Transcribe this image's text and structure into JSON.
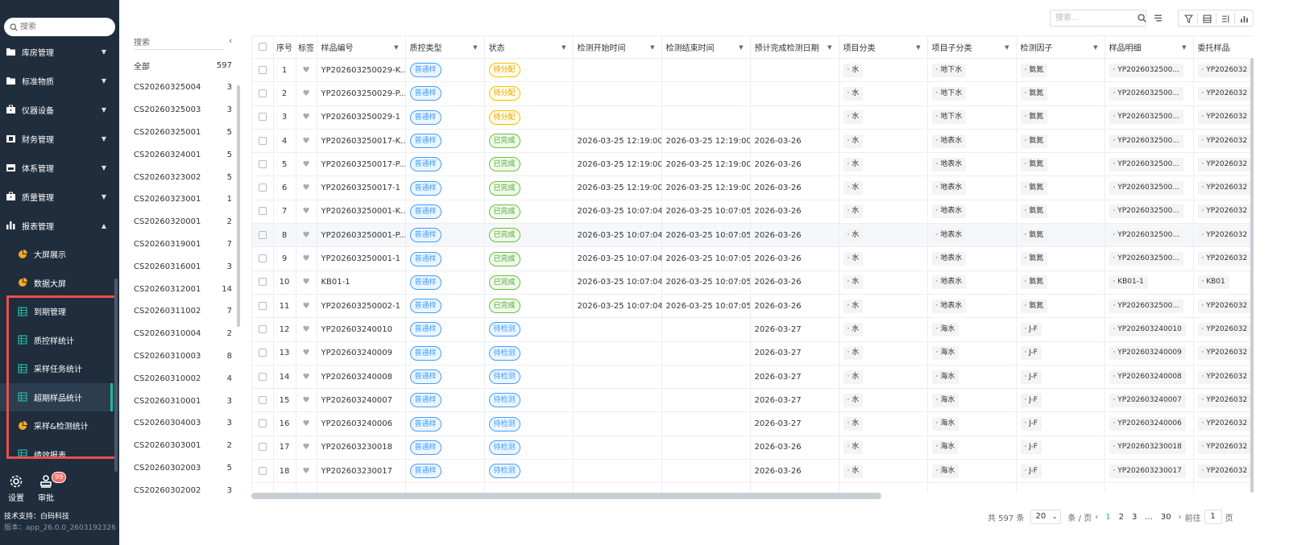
{
  "sidebar": {
    "search_placeholder": "搜索",
    "menu": [
      {
        "label": "库房管理",
        "icon": "folder-icon",
        "caret": "▼"
      },
      {
        "label": "标准物质",
        "icon": "folder-icon",
        "caret": "▼"
      },
      {
        "label": "仪器设备",
        "icon": "briefcase-icon",
        "caret": "▼"
      },
      {
        "label": "财务管理",
        "icon": "wallet-icon",
        "caret": "▼"
      },
      {
        "label": "体系管理",
        "icon": "calendar-icon",
        "caret": "▼"
      },
      {
        "label": "质量管理",
        "icon": "briefcase-icon",
        "caret": "▼"
      },
      {
        "label": "报表管理",
        "icon": "bar-chart-icon",
        "caret": "▲"
      }
    ],
    "submenu": [
      {
        "label": "大屏展示",
        "icon": "pie-icon"
      },
      {
        "label": "数据大屏",
        "icon": "pie-icon"
      },
      {
        "label": "到期管理",
        "icon": "table-icon"
      },
      {
        "label": "质控样统计",
        "icon": "table-icon"
      },
      {
        "label": "采样任务统计",
        "icon": "table-icon"
      },
      {
        "label": "超期样品统计",
        "icon": "table-icon",
        "active": true
      },
      {
        "label": "采样&检测统计",
        "icon": "pie-icon"
      },
      {
        "label": "绩效报表",
        "icon": "table-icon"
      }
    ],
    "tools": {
      "settings": "设置",
      "approval": "审批",
      "badge": "99"
    },
    "tech_support": "技术支持：白码科技",
    "version": "版本：app_26.0.0_2603192326..."
  },
  "toolbar": {
    "search_placeholder": "搜索..."
  },
  "left_list": {
    "search_label": "搜索",
    "items": [
      {
        "name": "全部",
        "count": "597"
      },
      {
        "name": "CS20260325004",
        "count": "3"
      },
      {
        "name": "CS20260325003",
        "count": "3"
      },
      {
        "name": "CS20260325001",
        "count": "5"
      },
      {
        "name": "CS20260324001",
        "count": "5"
      },
      {
        "name": "CS20260323002",
        "count": "5"
      },
      {
        "name": "CS20260323001",
        "count": "1"
      },
      {
        "name": "CS20260320001",
        "count": "2"
      },
      {
        "name": "CS20260319001",
        "count": "7"
      },
      {
        "name": "CS20260316001",
        "count": "3"
      },
      {
        "name": "CS20260312001",
        "count": "14"
      },
      {
        "name": "CS20260311002",
        "count": "7"
      },
      {
        "name": "CS20260310004",
        "count": "2"
      },
      {
        "name": "CS20260310003",
        "count": "8"
      },
      {
        "name": "CS20260310002",
        "count": "4"
      },
      {
        "name": "CS20260310001",
        "count": "3"
      },
      {
        "name": "CS20260304003",
        "count": "3"
      },
      {
        "name": "CS20260303001",
        "count": "2"
      },
      {
        "name": "CS20260302003",
        "count": "5"
      },
      {
        "name": "CS20260302002",
        "count": "3"
      }
    ]
  },
  "table": {
    "headers": [
      "序号",
      "标签",
      "样品编号",
      "质控类型",
      "状态",
      "检测开始时间",
      "检测结束时间",
      "预计完成检测日期",
      "项目分类",
      "项目子分类",
      "检测因子",
      "样品明细",
      "委托样品"
    ],
    "rows": [
      {
        "no": "1",
        "sample": "YP202603250029-K...",
        "qc": "普通样",
        "status": "待分配",
        "st": "yellow",
        "start": "",
        "end": "",
        "due": "",
        "cat": "· 水",
        "sub": "· 地下水",
        "factor": "· 氨氮",
        "detail": "· YP2026032500...",
        "entrust": "· YP2026032"
      },
      {
        "no": "2",
        "sample": "YP202603250029-P...",
        "qc": "普通样",
        "status": "待分配",
        "st": "yellow",
        "start": "",
        "end": "",
        "due": "",
        "cat": "· 水",
        "sub": "· 地下水",
        "factor": "· 氨氮",
        "detail": "· YP2026032500...",
        "entrust": "· YP2026032"
      },
      {
        "no": "3",
        "sample": "YP202603250029-1",
        "qc": "普通样",
        "status": "待分配",
        "st": "yellow",
        "start": "",
        "end": "",
        "due": "",
        "cat": "· 水",
        "sub": "· 地下水",
        "factor": "· 氨氮",
        "detail": "· YP2026032500...",
        "entrust": "· YP2026032"
      },
      {
        "no": "4",
        "sample": "YP202603250017-K...",
        "qc": "普通样",
        "status": "已完成",
        "st": "green",
        "start": "2026-03-25 12:19:00",
        "end": "2026-03-25 12:19:00",
        "due": "2026-03-26",
        "cat": "· 水",
        "sub": "· 地表水",
        "factor": "· 氨氮",
        "detail": "· YP2026032500...",
        "entrust": "· YP2026032"
      },
      {
        "no": "5",
        "sample": "YP202603250017-P...",
        "qc": "普通样",
        "status": "已完成",
        "st": "green",
        "start": "2026-03-25 12:19:00",
        "end": "2026-03-25 12:19:00",
        "due": "2026-03-26",
        "cat": "· 水",
        "sub": "· 地表水",
        "factor": "· 氨氮",
        "detail": "· YP2026032500...",
        "entrust": "· YP2026032"
      },
      {
        "no": "6",
        "sample": "YP202603250017-1",
        "qc": "普通样",
        "status": "已完成",
        "st": "green",
        "start": "2026-03-25 12:19:00",
        "end": "2026-03-25 12:19:00",
        "due": "2026-03-26",
        "cat": "· 水",
        "sub": "· 地表水",
        "factor": "· 氨氮",
        "detail": "· YP2026032500...",
        "entrust": "· YP2026032"
      },
      {
        "no": "7",
        "sample": "YP202603250001-K...",
        "qc": "普通样",
        "status": "已完成",
        "st": "green",
        "start": "2026-03-25 10:07:04",
        "end": "2026-03-25 10:07:05",
        "due": "2026-03-26",
        "cat": "· 水",
        "sub": "· 地表水",
        "factor": "· 氨氮",
        "detail": "· YP2026032500...",
        "entrust": "· YP2026032"
      },
      {
        "no": "8",
        "sample": "YP202603250001-P...",
        "qc": "普通样",
        "status": "已完成",
        "st": "green",
        "start": "2026-03-25 10:07:04",
        "end": "2026-03-25 10:07:05",
        "due": "2026-03-26",
        "cat": "· 水",
        "sub": "· 地表水",
        "factor": "· 氨氮",
        "detail": "· YP2026032500...",
        "entrust": "· YP2026032"
      },
      {
        "no": "9",
        "sample": "YP202603250001-1",
        "qc": "普通样",
        "status": "已完成",
        "st": "green",
        "start": "2026-03-25 10:07:04",
        "end": "2026-03-25 10:07:05",
        "due": "2026-03-26",
        "cat": "· 水",
        "sub": "· 地表水",
        "factor": "· 氨氮",
        "detail": "· YP2026032500...",
        "entrust": "· YP2026032"
      },
      {
        "no": "10",
        "sample": "KB01-1",
        "qc": "普通样",
        "status": "已完成",
        "st": "green",
        "start": "2026-03-25 10:07:04",
        "end": "2026-03-25 10:07:05",
        "due": "2026-03-26",
        "cat": "· 水",
        "sub": "· 地表水",
        "factor": "· 氨氮",
        "detail": "· KB01-1",
        "entrust": "· KB01"
      },
      {
        "no": "11",
        "sample": "YP202603250002-1",
        "qc": "普通样",
        "status": "已完成",
        "st": "green",
        "start": "2026-03-25 10:07:04",
        "end": "2026-03-25 10:07:05",
        "due": "2026-03-26",
        "cat": "· 水",
        "sub": "· 地表水",
        "factor": "· 氨氮",
        "detail": "· YP2026032500...",
        "entrust": "· YP2026032"
      },
      {
        "no": "12",
        "sample": "YP202603240010",
        "qc": "普通样",
        "status": "待检测",
        "st": "blue",
        "start": "",
        "end": "",
        "due": "2026-03-27",
        "cat": "· 水",
        "sub": "· 海水",
        "factor": "· J-F",
        "detail": "· YP202603240010",
        "entrust": "· YP2026032"
      },
      {
        "no": "13",
        "sample": "YP202603240009",
        "qc": "普通样",
        "status": "待检测",
        "st": "blue",
        "start": "",
        "end": "",
        "due": "2026-03-27",
        "cat": "· 水",
        "sub": "· 海水",
        "factor": "· J-F",
        "detail": "· YP202603240009",
        "entrust": "· YP2026032"
      },
      {
        "no": "14",
        "sample": "YP202603240008",
        "qc": "普通样",
        "status": "待检测",
        "st": "blue",
        "start": "",
        "end": "",
        "due": "2026-03-27",
        "cat": "· 水",
        "sub": "· 海水",
        "factor": "· J-F",
        "detail": "· YP202603240008",
        "entrust": "· YP2026032"
      },
      {
        "no": "15",
        "sample": "YP202603240007",
        "qc": "普通样",
        "status": "待检测",
        "st": "blue",
        "start": "",
        "end": "",
        "due": "2026-03-27",
        "cat": "· 水",
        "sub": "· 海水",
        "factor": "· J-F",
        "detail": "· YP202603240007",
        "entrust": "· YP2026032"
      },
      {
        "no": "16",
        "sample": "YP202603240006",
        "qc": "普通样",
        "status": "待检测",
        "st": "blue",
        "start": "",
        "end": "",
        "due": "2026-03-27",
        "cat": "· 水",
        "sub": "· 海水",
        "factor": "· J-F",
        "detail": "· YP202603240006",
        "entrust": "· YP2026032"
      },
      {
        "no": "17",
        "sample": "YP202603230018",
        "qc": "普通样",
        "status": "待检测",
        "st": "blue",
        "start": "",
        "end": "",
        "due": "2026-03-26",
        "cat": "· 水",
        "sub": "· 海水",
        "factor": "· J-F",
        "detail": "· YP202603230018",
        "entrust": "· YP2026032"
      },
      {
        "no": "18",
        "sample": "YP202603230017",
        "qc": "普通样",
        "status": "待检测",
        "st": "blue",
        "start": "",
        "end": "",
        "due": "2026-03-26",
        "cat": "· 水",
        "sub": "· 海水",
        "factor": "· J-F",
        "detail": "· YP202603230017",
        "entrust": "· YP2026032"
      }
    ]
  },
  "pagination": {
    "total": "共 597 条",
    "page_size": "20",
    "per_page_label": "条 / 页",
    "pages": [
      "1",
      "2",
      "3",
      "...",
      "30"
    ],
    "goto_label": "前往",
    "goto_value": "1",
    "page_suffix": "页"
  },
  "colors": {
    "accent": "#22b8a3",
    "sidebar_bg": "#1f2d3d",
    "highlight": "#ee4d4d"
  }
}
